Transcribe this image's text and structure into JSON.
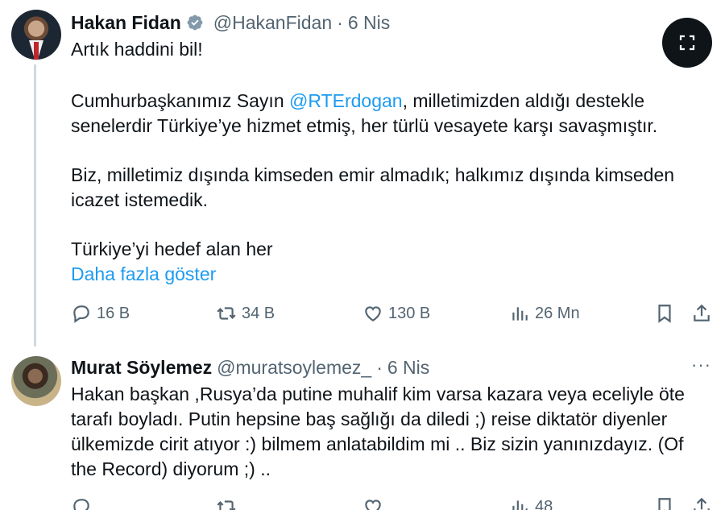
{
  "tweets": [
    {
      "author_name": "Hakan Fidan",
      "handle": "@HakanFidan",
      "separator": "·",
      "date": "6 Nis",
      "verified": true,
      "text": {
        "line1": "Artık haddini bil!",
        "p2_prefix": "Cumhurbaşkanımız Sayın ",
        "mention": "@RTErdogan",
        "p2_suffix": ", milletimizden aldığı destekle",
        "p2_line2": "senelerdir Türkiye’ye hizmet etmiş, her türlü vesayete karşı savaşmıştır.",
        "p3_line1": "Biz, milletimiz dışında kimseden emir almadık; halkımız dışında kimseden",
        "p3_line2": "icazet istemedik.",
        "p4_line1": "Türkiye’yi hedef alan her",
        "show_more": "Daha fazla göster"
      },
      "actions": {
        "replies": "16 B",
        "retweets": "34 B",
        "likes": "130 B",
        "views": "26 Mn"
      },
      "icons": [
        "reply-icon",
        "retweet-icon",
        "like-icon",
        "views-icon",
        "bookmark-icon",
        "share-icon",
        "expand-icon"
      ]
    },
    {
      "author_name": "Murat Söylemez",
      "handle": "@muratsoylemez_",
      "separator": "·",
      "date": "6 Nis",
      "more": "···",
      "text": {
        "line1": "Hakan başkan ,Rusya’da putine muhalif kim varsa kazara veya eceliyle öte",
        "line2": "tarafı boyladı. Putin hepsine baş sağlığı da diledi ;) reise diktatör diyenler",
        "line3": "ülkemizde cirit atıyor    :) bilmem anlatabildim mi .. Biz sizin yanınızdayız. (Of",
        "line4": "the Record) diyorum   ;) .."
      },
      "actions": {
        "views": "48"
      }
    }
  ],
  "colors": {
    "text": "#0f1419",
    "secondary": "#536471",
    "link": "#1d9bf0",
    "verified": "#829aab",
    "thread_line": "#cfd9de"
  }
}
